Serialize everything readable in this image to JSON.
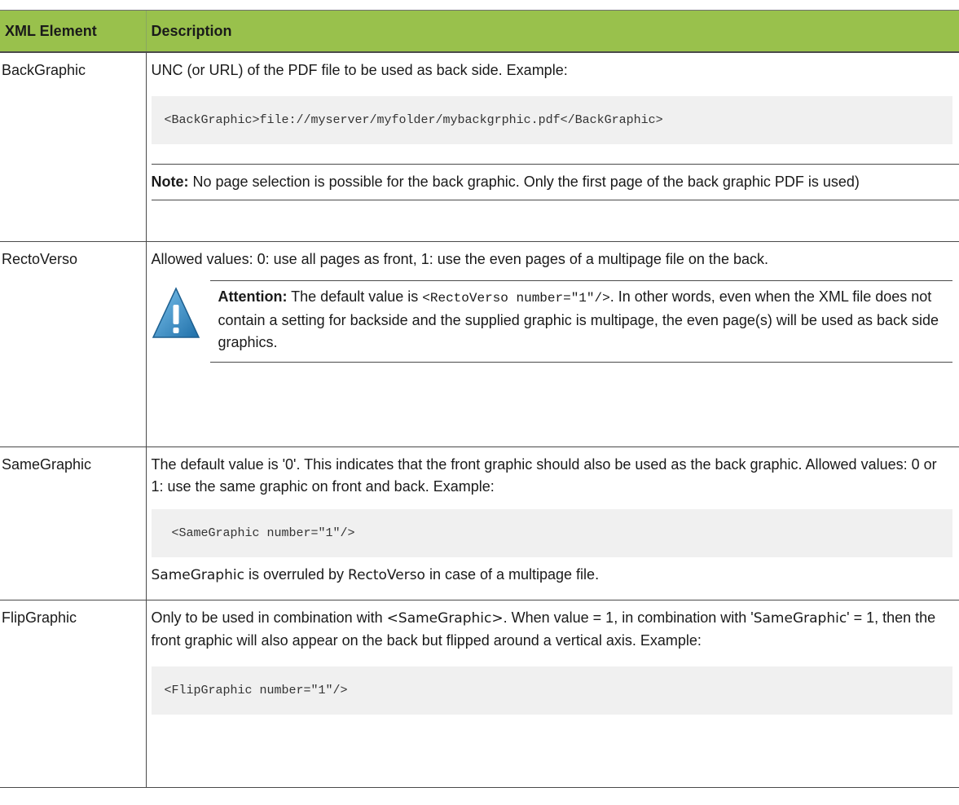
{
  "header": {
    "col1": "XML Element",
    "col2": "Description"
  },
  "rows": [
    {
      "element": "BackGraphic",
      "text": "UNC (or URL) of the PDF file to be used as back side. Example:",
      "code": "<BackGraphic>file://myserver/myfolder/mybackgrphic.pdf</BackGraphic>",
      "note_label": "Note:",
      "note_text": " No page selection is possible for the back graphic. Only the first page of the back graphic PDF is used)"
    },
    {
      "element": "RectoVerso",
      "text": "Allowed values: 0: use all pages as front, 1: use the even pages of a multipage file on the back.",
      "attn_label": "Attention:",
      "attn_text1": " The default value is ",
      "attn_code": "<RectoVerso number=\"1\"/>",
      "attn_text2": ". In other words, even when the XML file does not contain a setting for backside and the supplied graphic is multipage, the even page(s) will be used as back side graphics."
    },
    {
      "element": "SameGraphic",
      "text": "The default value is '0'. This indicates that the front graphic should also be used as the back graphic. Allowed values: 0 or 1: use the same graphic on front and back. Example:",
      "code": " <SameGraphic number=\"1\"/>",
      "after_a": "SameGraphic",
      "after_b": " is overruled by ",
      "after_c": "RectoVerso",
      "after_d": " in case of a multipage file."
    },
    {
      "element": "FlipGraphic",
      "text_a": "Only to be used in combination with ",
      "text_b": "<SameGraphic>",
      "text_c": ". When value = 1, in combination with '",
      "text_d": "SameGraphic",
      "text_e": "' = 1, then the front graphic will also appear on the back but flipped around a vertical axis. Example:",
      "code": "<FlipGraphic number=\"1\"/>"
    }
  ],
  "colors": {
    "header_bg": "#99c14c",
    "code_bg": "#f0f0f0",
    "warning_icon": "#2a8fd0"
  }
}
